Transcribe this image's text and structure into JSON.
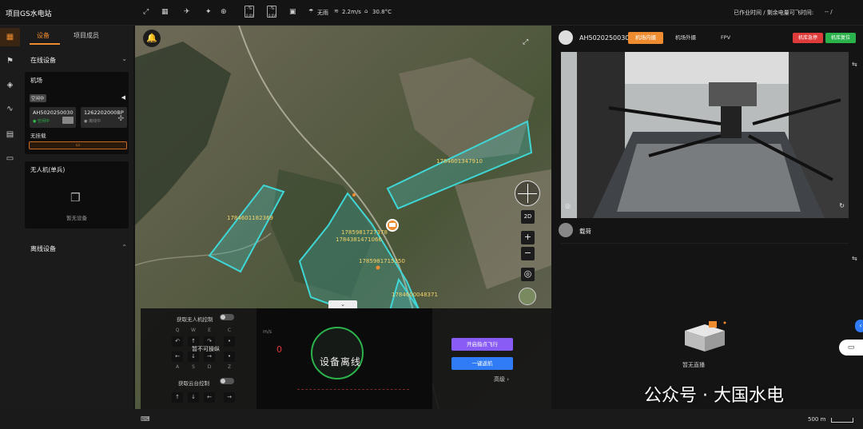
{
  "app": {
    "title": "项目GS水电站"
  },
  "topbar": {
    "battery1": {
      "label": "-%",
      "pct": "0.0V"
    },
    "battery2": {
      "label": "-%",
      "pct": "0.0V"
    },
    "weather": "无雨",
    "wind": "2.2m/s",
    "temp": "30.8°C",
    "work_time": "已作业时间 / 剩余电量可飞时间:",
    "work_value": "--  /"
  },
  "left": {
    "tabs": {
      "devices": "设备",
      "results": "项目成员"
    },
    "online_title": "在线设备",
    "dock_card": {
      "title": "机场",
      "status_badge": "空闲中",
      "docks": [
        {
          "id": "AH5020250030",
          "state": "● 空闲中"
        },
        {
          "id": "1262202000BP",
          "state": "● 离线中"
        }
      ],
      "no_mount": "无挂载"
    },
    "uav_card": {
      "title": "无人机(单兵)",
      "empty": "暂无设备"
    },
    "offline_title": "离线设备"
  },
  "map": {
    "areas": [
      "1784601347910",
      "1784601182369",
      "1785981727378",
      "1784381471066",
      "1785981715350",
      "1784600048371"
    ],
    "zoom_mode": "2D",
    "zoom_in": "+",
    "zoom_out": "−"
  },
  "control": {
    "uav_control_label": "获取无人机控制",
    "gimbal_control_label": "获取云台控制",
    "keys_top": [
      "Q",
      "W",
      "E",
      "C"
    ],
    "keys_bottom": [
      "A",
      "S",
      "D",
      "Z"
    ],
    "no_op": "暂不可操纵",
    "offline": "设备离线",
    "btn_dot": "开启指点飞行",
    "btn_return": "一键返航",
    "advanced": "高级 ›",
    "speed_unit": "m/s",
    "speed_val": "0"
  },
  "right": {
    "dock_sn": "AH5020250030",
    "tabs": [
      "机场内摄",
      "机场外摄",
      "FPV"
    ],
    "btn_red": "机库急停",
    "btn_green": "机库复位",
    "uav_title": "载荷",
    "no_live": "暂无直播"
  },
  "bottom": {
    "scale": "500 m"
  },
  "watermark": "公众号 · 大国水电",
  "colors": {
    "accent": "#f08c30",
    "area": "#3fd6d6",
    "purple": "#8a5cf6",
    "blue": "#2f7cf6",
    "red": "#e03b3b",
    "green": "#2bb24a"
  }
}
